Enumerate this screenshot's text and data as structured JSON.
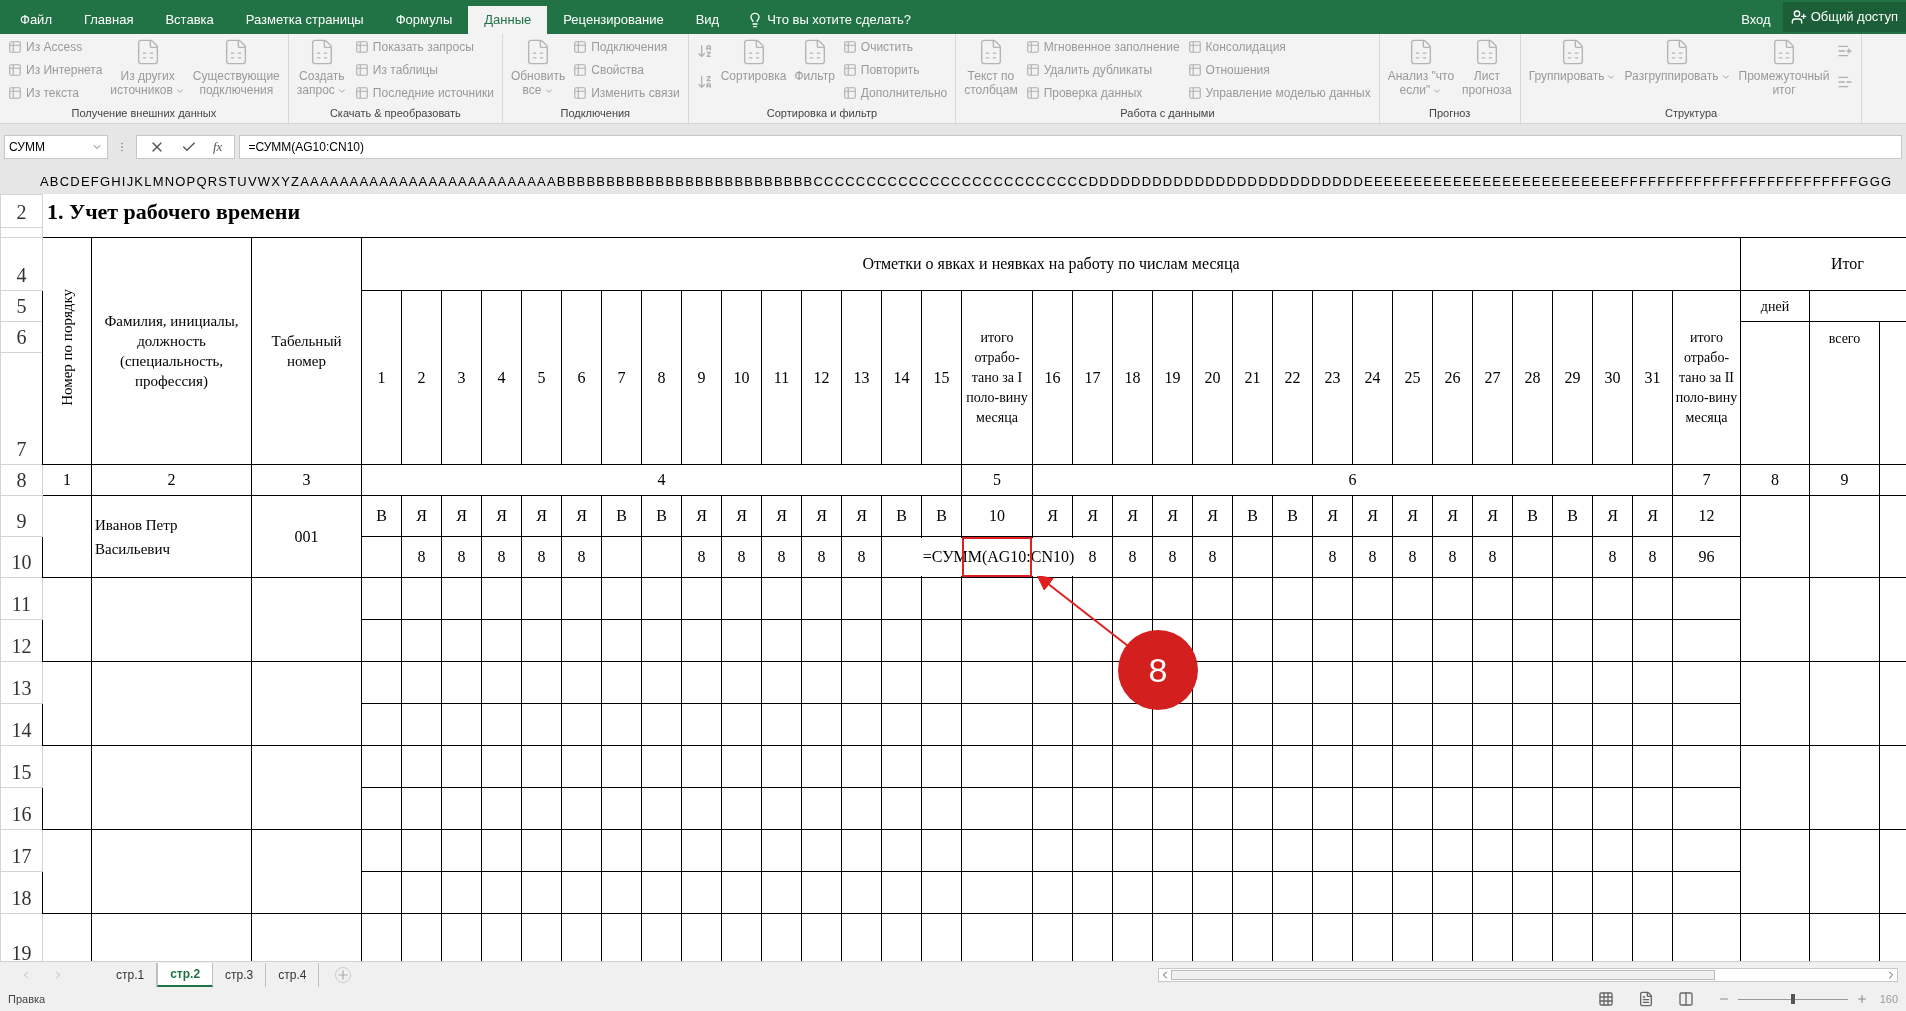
{
  "ribbon_tabs": [
    {
      "label": "Файл",
      "selected": false
    },
    {
      "label": "Главная",
      "selected": false
    },
    {
      "label": "Вставка",
      "selected": false
    },
    {
      "label": "Разметка страницы",
      "selected": false
    },
    {
      "label": "Формулы",
      "selected": false
    },
    {
      "label": "Данные",
      "selected": true
    },
    {
      "label": "Рецензирование",
      "selected": false
    },
    {
      "label": "Вид",
      "selected": false
    }
  ],
  "tell_me": "Что вы хотите сделать?",
  "sign_in": "Вход",
  "share": "Общий доступ",
  "ribbon_groups": [
    {
      "label": "Получение внешних данных",
      "columns": [
        {
          "kind": "stack",
          "items": [
            {
              "kind": "small",
              "label": "Из Access"
            },
            {
              "kind": "small",
              "label": "Из Интернета"
            },
            {
              "kind": "small",
              "label": "Из текста"
            }
          ]
        },
        {
          "kind": "large",
          "label": "Из других\nисточников",
          "dropdown": true
        },
        {
          "kind": "large",
          "label": "Существующие\nподключения",
          "dropdown": false
        }
      ]
    },
    {
      "label": "Скачать & преобразовать",
      "columns": [
        {
          "kind": "large",
          "label": "Создать\nзапрос",
          "dropdown": true
        },
        {
          "kind": "stack",
          "items": [
            {
              "kind": "small",
              "label": "Показать запросы"
            },
            {
              "kind": "small",
              "label": "Из таблицы"
            },
            {
              "kind": "small",
              "label": "Последние источники"
            }
          ]
        }
      ]
    },
    {
      "label": "Подключения",
      "columns": [
        {
          "kind": "large",
          "label": "Обновить\nвсе",
          "dropdown": true
        },
        {
          "kind": "stack",
          "items": [
            {
              "kind": "small",
              "label": "Подключения"
            },
            {
              "kind": "small",
              "label": "Свойства"
            },
            {
              "kind": "small",
              "label": "Изменить связи"
            }
          ]
        }
      ]
    },
    {
      "label": "Сортировка и фильтр",
      "columns": [
        {
          "kind": "stack",
          "items": [
            {
              "kind": "icon"
            },
            {
              "kind": "icon"
            }
          ]
        },
        {
          "kind": "large",
          "label": "Сортировка",
          "dropdown": false
        },
        {
          "kind": "large",
          "label": "Фильтр",
          "dropdown": false
        },
        {
          "kind": "stack",
          "items": [
            {
              "kind": "small",
              "label": "Очистить"
            },
            {
              "kind": "small",
              "label": "Повторить"
            },
            {
              "kind": "small",
              "label": "Дополнительно"
            }
          ]
        }
      ]
    },
    {
      "label": "Работа с данными",
      "columns": [
        {
          "kind": "large",
          "label": "Текст по\nстолбцам",
          "dropdown": false
        },
        {
          "kind": "stack",
          "items": [
            {
              "kind": "small",
              "label": "Мгновенное заполнение"
            },
            {
              "kind": "small",
              "label": "Удалить дубликаты"
            },
            {
              "kind": "small",
              "label": "Проверка данных"
            }
          ]
        },
        {
          "kind": "stack",
          "items": [
            {
              "kind": "small",
              "label": "Консолидация"
            },
            {
              "kind": "small",
              "label": "Отношения"
            },
            {
              "kind": "small",
              "label": "Управление моделью данных"
            }
          ]
        }
      ]
    },
    {
      "label": "Прогноз",
      "columns": [
        {
          "kind": "large",
          "label": "Анализ \"что\nесли\"",
          "dropdown": true
        },
        {
          "kind": "large",
          "label": "Лист\nпрогноза",
          "dropdown": false
        }
      ]
    },
    {
      "label": "Структура",
      "columns": [
        {
          "kind": "large",
          "label": "Группировать",
          "dropdown": true
        },
        {
          "kind": "large",
          "label": "Разгруппировать",
          "dropdown": true
        },
        {
          "kind": "large",
          "label": "Промежуточный\nитог",
          "dropdown": false
        },
        {
          "kind": "stack",
          "items": [
            {
              "kind": "icon"
            },
            {
              "kind": "icon"
            }
          ]
        }
      ]
    }
  ],
  "name_box": "СУММ",
  "fx": "fx",
  "formula": "=СУММ(AG10:CN10)",
  "column_headers": "ABCDEFGHIJKLMNOPQRSTUVWXYZAAAAAAAAAAAAAAAAAAAAAAAAAABBBBBBBBBBBBBBBBBBBBBBBBBBCCCCCCCCCCCCCCCCCCCCCCCCCCDDDDDDDDDDDDDDDDDDDDDDDDDDEEEEEEEEEEEEEEEEEEEEEEEEEEFFFFFFFFFFFFFFFFFFFFFFFFFFGGG",
  "row_numbers": [
    "2",
    "4",
    "5",
    "6",
    "7",
    "8",
    "9",
    "10",
    "11",
    "12",
    "13",
    "14",
    "15",
    "16",
    "17",
    "18",
    "19"
  ],
  "table": {
    "title": "1. Учет рабочего времени",
    "header": {
      "number": "Номер по порядку",
      "name": "Фамилия, инициалы, должность (специальность, профессия)",
      "tab_number": "Табельный номер",
      "marks": "Отметки о явках и неявках на работу по числам месяца",
      "total": "Итог",
      "days_label": "дней",
      "all_label": "всего",
      "days_first": [
        "1",
        "2",
        "3",
        "4",
        "5",
        "6",
        "7",
        "8",
        "9",
        "10",
        "11",
        "12",
        "13",
        "14",
        "15"
      ],
      "half_first": "итого отрабо-тано за I поло-вину месяца",
      "days_second": [
        "16",
        "17",
        "18",
        "19",
        "20",
        "21",
        "22",
        "23",
        "24",
        "25",
        "26",
        "27",
        "28",
        "29",
        "30",
        "31"
      ],
      "half_second": "итого отрабо-тано за II поло-вину месяца"
    },
    "column_numbers": [
      "1",
      "2",
      "3",
      "4",
      "5",
      "6",
      "7",
      "8",
      "9"
    ],
    "employee": {
      "name": "Иванов Петр Васильевич",
      "tab_number": "001",
      "marks_first": [
        "В",
        "Я",
        "Я",
        "Я",
        "Я",
        "Я",
        "В",
        "В",
        "Я",
        "Я",
        "Я",
        "Я",
        "Я",
        "В",
        "В"
      ],
      "marks_first_total": "10",
      "marks_second": [
        "Я",
        "Я",
        "Я",
        "Я",
        "Я",
        "В",
        "В",
        "Я",
        "Я",
        "Я",
        "Я",
        "Я",
        "В",
        "В",
        "Я",
        "Я"
      ],
      "marks_second_total": "12",
      "hours_first": [
        {
          "kind": "empty"
        },
        {
          "kind": "value",
          "value": "8"
        },
        {
          "kind": "value",
          "value": "8"
        },
        {
          "kind": "value",
          "value": "8"
        },
        {
          "kind": "value",
          "value": "8"
        },
        {
          "kind": "value",
          "value": "8"
        },
        {
          "kind": "empty"
        },
        {
          "kind": "empty"
        },
        {
          "kind": "value",
          "value": "8"
        },
        {
          "kind": "value",
          "value": "8"
        },
        {
          "kind": "value",
          "value": "8"
        },
        {
          "kind": "value",
          "value": "8"
        },
        {
          "kind": "value",
          "value": "8"
        },
        {
          "kind": "empty"
        },
        {
          "kind": "empty"
        }
      ],
      "cell_edit": "=СУММ(AG10:CN10)",
      "hours_second": [
        {
          "kind": "empty"
        },
        {
          "kind": "value",
          "value": "8"
        },
        {
          "kind": "value",
          "value": "8"
        },
        {
          "kind": "value",
          "value": "8"
        },
        {
          "kind": "value",
          "value": "8"
        },
        {
          "kind": "empty"
        },
        {
          "kind": "empty"
        },
        {
          "kind": "value",
          "value": "8"
        },
        {
          "kind": "value",
          "value": "8"
        },
        {
          "kind": "value",
          "value": "8"
        },
        {
          "kind": "value",
          "value": "8"
        },
        {
          "kind": "value",
          "value": "8"
        },
        {
          "kind": "empty"
        },
        {
          "kind": "empty"
        },
        {
          "kind": "value",
          "value": "8"
        },
        {
          "kind": "value",
          "value": "8"
        }
      ],
      "hours_second_total": "96"
    },
    "annotation": "8"
  },
  "sheet_tabs": [
    {
      "label": "стр.1",
      "selected": false
    },
    {
      "label": "стр.2",
      "selected": true
    },
    {
      "label": "стр.3",
      "selected": false
    },
    {
      "label": "стр.4",
      "selected": false
    }
  ],
  "status": "Правка",
  "zoom_slider": {
    "level": 0.5
  },
  "zoom": "160"
}
